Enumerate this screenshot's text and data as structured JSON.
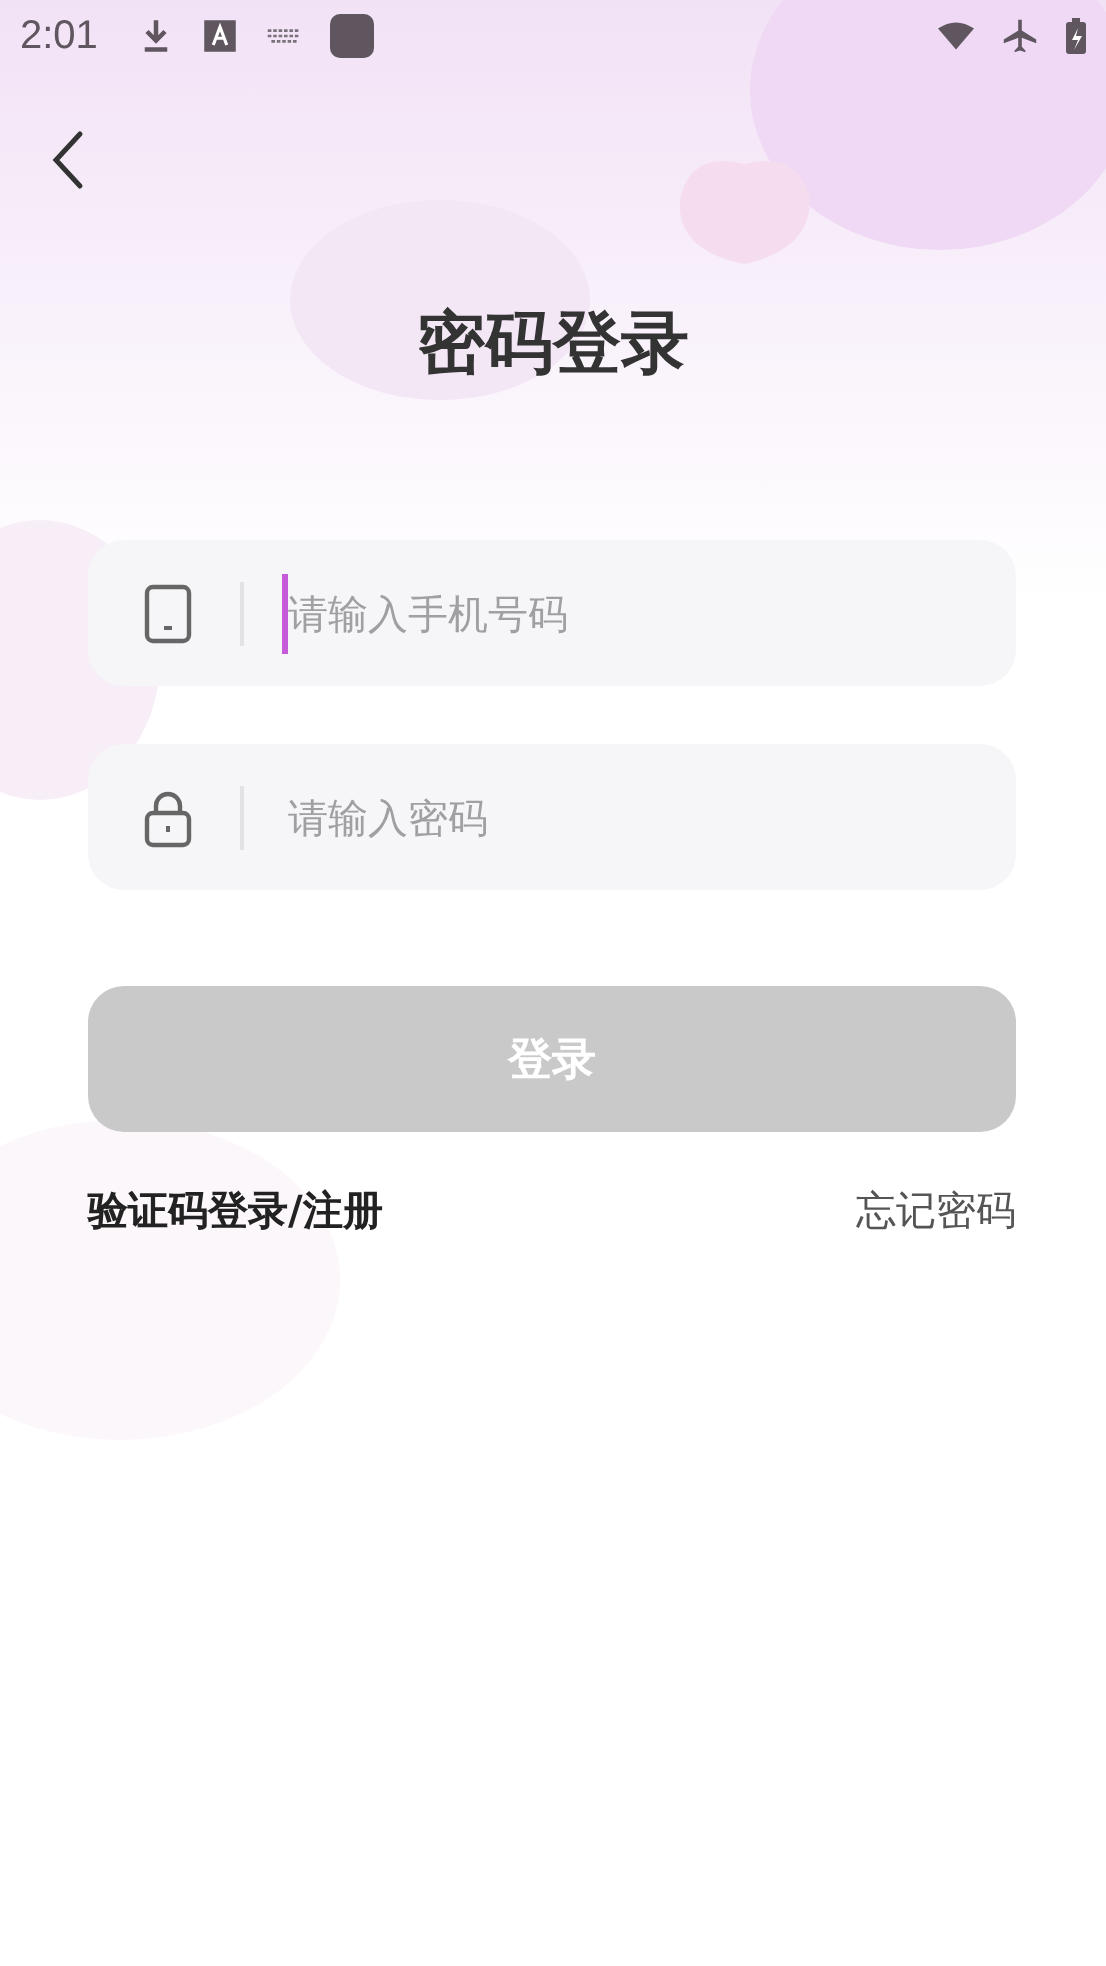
{
  "status_bar": {
    "time": "2:01"
  },
  "title": "密码登录",
  "fields": [
    {
      "kind": "phone",
      "placeholder": "请输入手机号码",
      "focused": true
    },
    {
      "kind": "password",
      "placeholder": "请输入密码",
      "focused": false
    }
  ],
  "login_button": {
    "label": "登录",
    "disabled": true
  },
  "links": {
    "left": "验证码登录/注册",
    "right": "忘记密码"
  }
}
